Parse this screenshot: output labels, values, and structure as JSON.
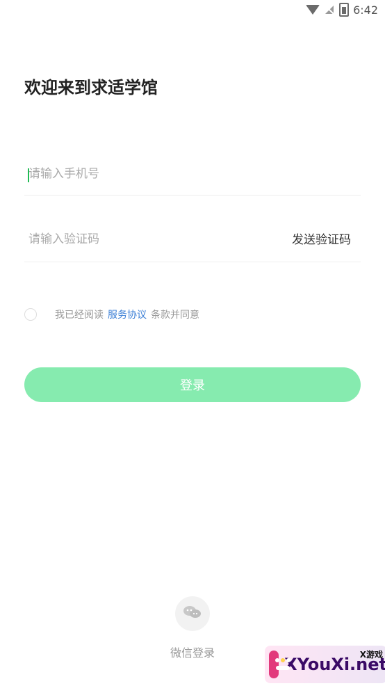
{
  "status_bar": {
    "time": "6:42"
  },
  "page_title": "欢迎来到求适学馆",
  "phone": {
    "placeholder": "请输入手机号",
    "value": ""
  },
  "code": {
    "placeholder": "请输入验证码",
    "value": "",
    "send_label": "发送验证码"
  },
  "agreement": {
    "prefix": "我已经阅读",
    "link": "服务协议",
    "suffix": "条款并同意"
  },
  "login_label": "登录",
  "wechat_label": "微信登录",
  "watermark": {
    "text": "XYouXi.net",
    "small": "X游戏"
  },
  "colors": {
    "accent_green": "#86ebaf",
    "link_blue": "#3b7fd6"
  },
  "icons": {
    "wifi": "wifi-icon",
    "no_signal": "no-signal-icon",
    "battery": "battery-icon",
    "wechat": "wechat-icon"
  }
}
